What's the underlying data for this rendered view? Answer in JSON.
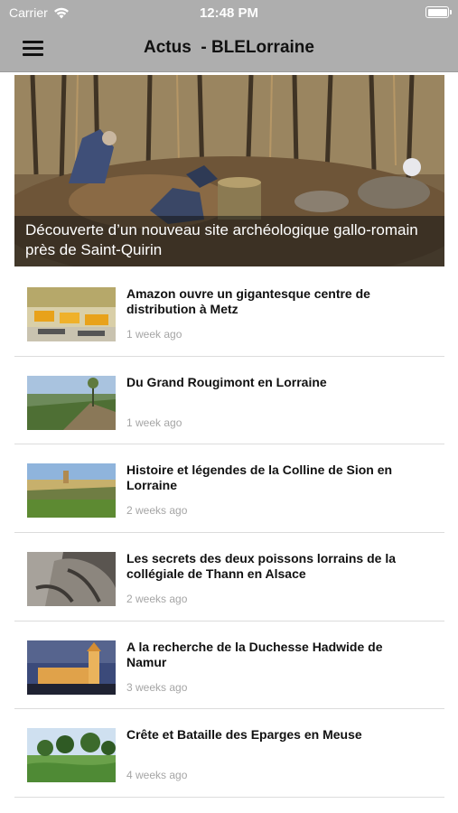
{
  "status_bar": {
    "carrier": "Carrier",
    "time": "12:48 PM",
    "icons": [
      "wifi-icon",
      "battery-icon"
    ]
  },
  "nav": {
    "title": "Actus  - BLELorraine",
    "menu_icon": "hamburger-menu-icon"
  },
  "hero": {
    "caption": "Découverte d’un nouveau site archéologique gallo-romain près de Saint-Quirin"
  },
  "articles": [
    {
      "title": "Amazon ouvre un gigantesque centre de distribution à Metz",
      "age": "1 week ago"
    },
    {
      "title": "Du Grand Rougimont en Lorraine",
      "age": "1 week ago"
    },
    {
      "title": "Histoire et légendes de la Colline de Sion en Lorraine",
      "age": "2 weeks ago"
    },
    {
      "title": "Les secrets des deux poissons lorrains de la collégiale de Thann en Alsace",
      "age": "2 weeks ago"
    },
    {
      "title": "A la recherche de la Duchesse Hadwide de Namur",
      "age": "3 weeks ago"
    },
    {
      "title": "Crête et Bataille des Eparges en Meuse",
      "age": "4 weeks ago"
    }
  ],
  "colors": {
    "bar_background": "#aeaeae",
    "divider": "#dcdcdc",
    "age_text": "#a5a5a5"
  }
}
